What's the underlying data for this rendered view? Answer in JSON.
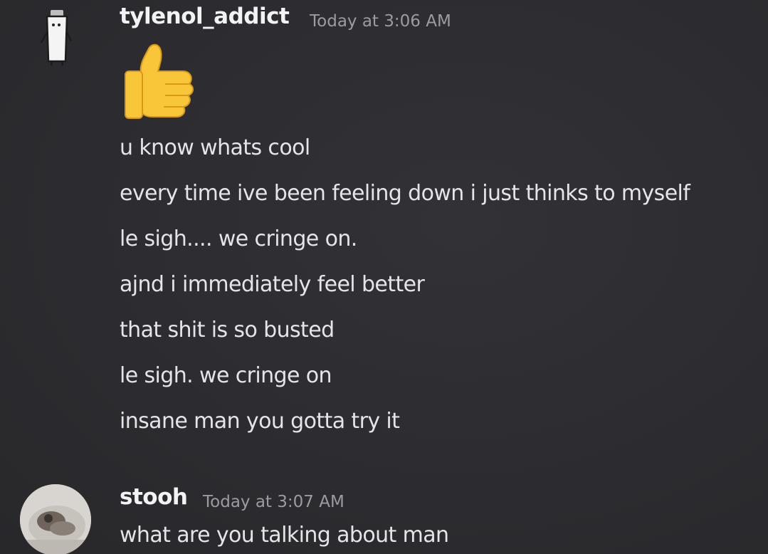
{
  "messages": [
    {
      "username": "tylenol_addict",
      "timestamp": "Today at 3:06 AM",
      "avatar": "tylenol-bottle-avatar",
      "emoji": "thumbs-up",
      "lines": [
        "u know whats cool",
        "every time ive been feeling down i just thinks to myself",
        "le sigh.... we cringe on.",
        "ajnd i immediately feel better",
        "that shit is so busted",
        "le sigh. we cringe on",
        "insane man you gotta try it"
      ]
    },
    {
      "username": "stooh",
      "timestamp": "Today at 3:07 AM",
      "avatar": "photo-avatar",
      "lines": [
        "what are you  talking about man"
      ]
    }
  ],
  "colors": {
    "background": "#2d2d31",
    "username": "#f2f3f5",
    "timestamp": "#9a9ca2",
    "message_text": "#e4e5e8",
    "emoji_yellow": "#f9c63a"
  }
}
